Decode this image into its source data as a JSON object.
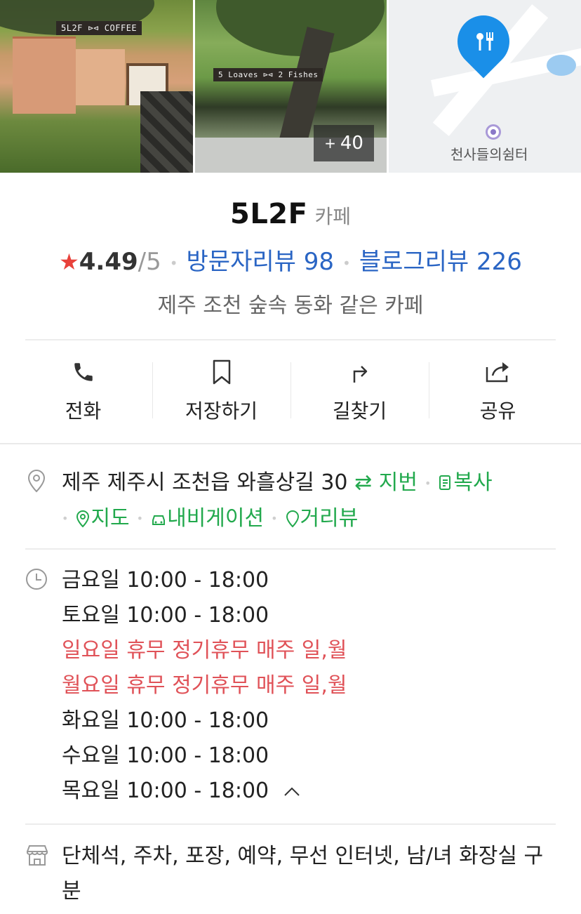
{
  "photos": {
    "photo1_sign": "5L2F ⊳⊲ COFFEE",
    "photo2_sign": "5 Loaves ⊳⊲ 2 Fishes",
    "more_count": "40",
    "more_plus": "+",
    "map_poi": "천사들의쉼터"
  },
  "place": {
    "name": "5L2F",
    "category": "카페",
    "rating": "4.49",
    "rating_max": "/5",
    "visitor_reviews": "방문자리뷰 98",
    "blog_reviews": "블로그리뷰 226",
    "description": "제주 조천 숲속 동화 같은 카페"
  },
  "actions": [
    {
      "label": "전화",
      "icon": "phone-icon"
    },
    {
      "label": "저장하기",
      "icon": "bookmark-icon"
    },
    {
      "label": "길찾기",
      "icon": "directions-icon"
    },
    {
      "label": "공유",
      "icon": "share-icon"
    }
  ],
  "address": {
    "text": "제주 제주시 조천읍 와흘상길 30",
    "lot": "지번",
    "copy": "복사",
    "map": "지도",
    "navigation": "내비게이션",
    "streetview": "거리뷰"
  },
  "hours": [
    {
      "text": "금요일 10:00 - 18:00",
      "closed": false
    },
    {
      "text": "토요일 10:00 - 18:00",
      "closed": false
    },
    {
      "text": "일요일 휴무 정기휴무 매주 일,월",
      "closed": true
    },
    {
      "text": "월요일 휴무 정기휴무 매주 일,월",
      "closed": true
    },
    {
      "text": "화요일 10:00 - 18:00",
      "closed": false
    },
    {
      "text": "수요일 10:00 - 18:00",
      "closed": false
    },
    {
      "text": "목요일 10:00 - 18:00",
      "closed": false
    }
  ],
  "amenities": "단체석, 주차, 포장, 예약, 무선 인터넷, 남/녀 화장실 구분",
  "colors": {
    "star": "#e8413a",
    "review_link": "#2a65c4",
    "green_link": "#22a94d",
    "closed": "#e05258",
    "map_pin": "#1a8fe8"
  }
}
